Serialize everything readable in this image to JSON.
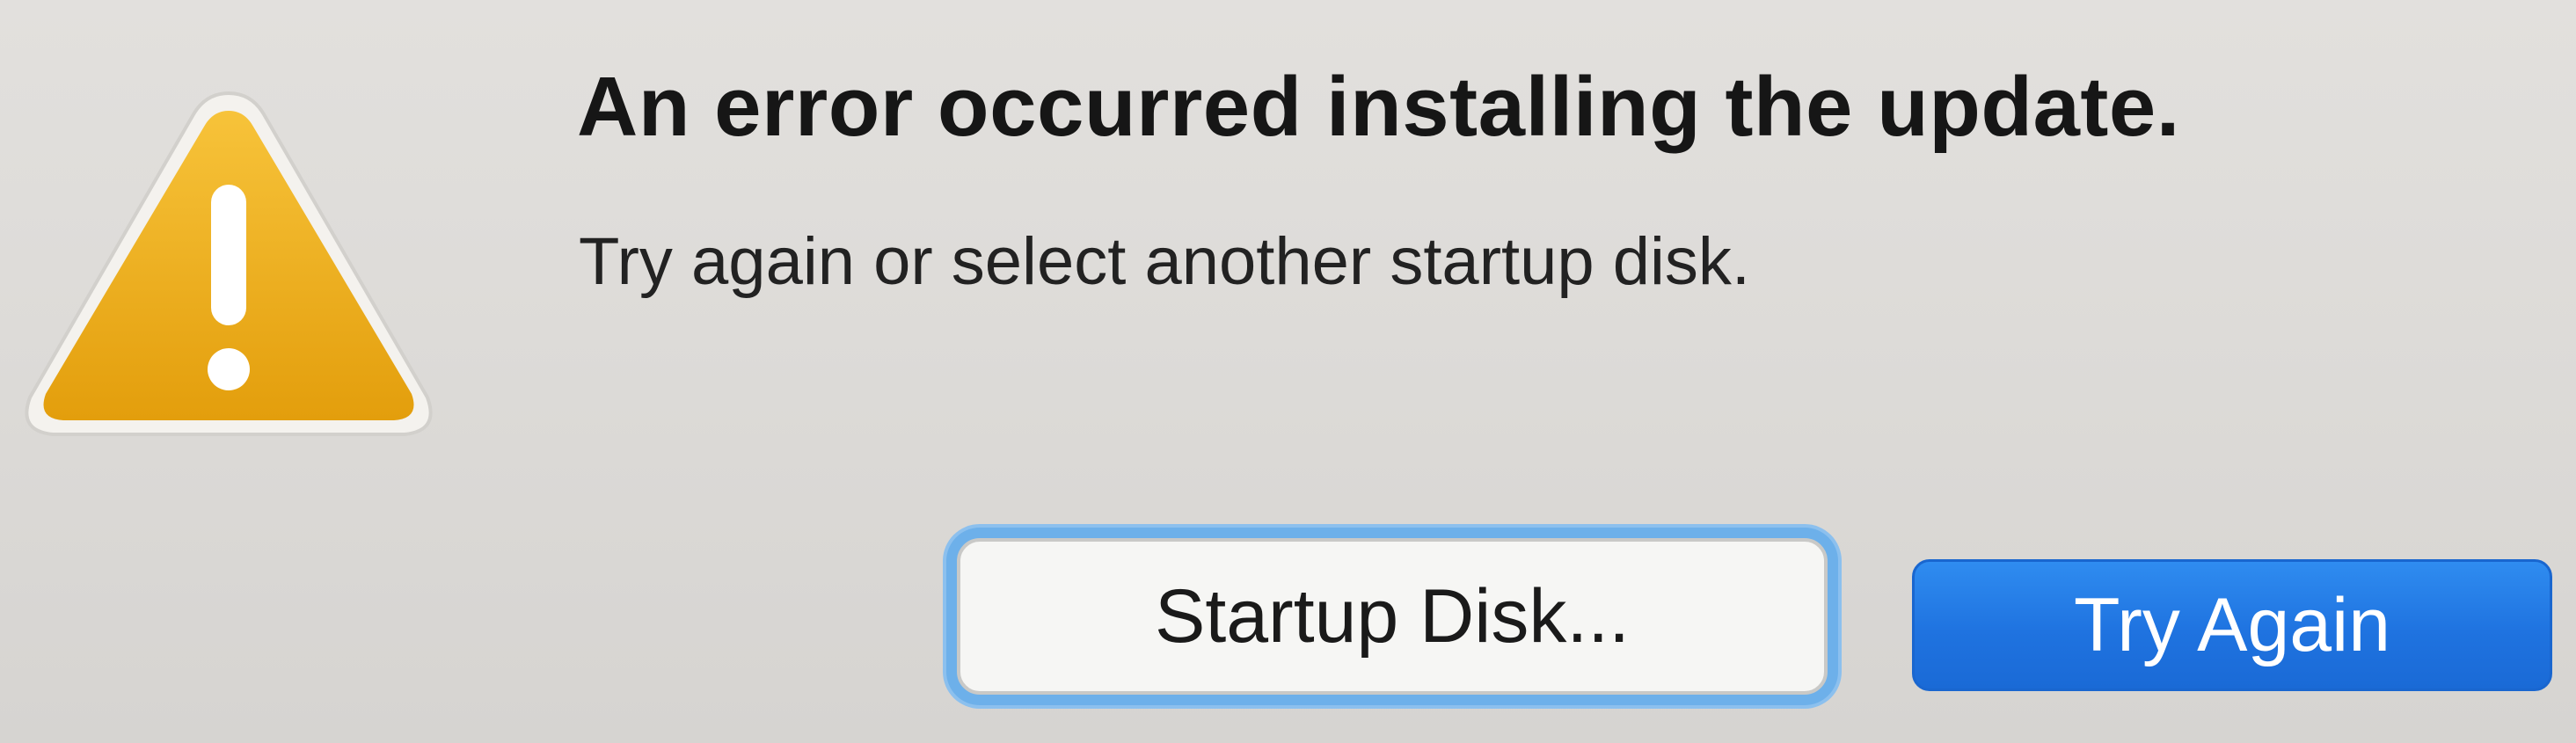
{
  "dialog": {
    "title": "An error occurred installing the update.",
    "message": "Try again or select another startup disk.",
    "icon": "warning-icon"
  },
  "buttons": {
    "startup_disk_label": "Startup Disk...",
    "try_again_label": "Try Again"
  },
  "colors": {
    "warning_icon": "#f0b21a",
    "primary_button": "#1f73e0",
    "focus_ring": "#6db0ea",
    "background": "#dcdad7"
  }
}
